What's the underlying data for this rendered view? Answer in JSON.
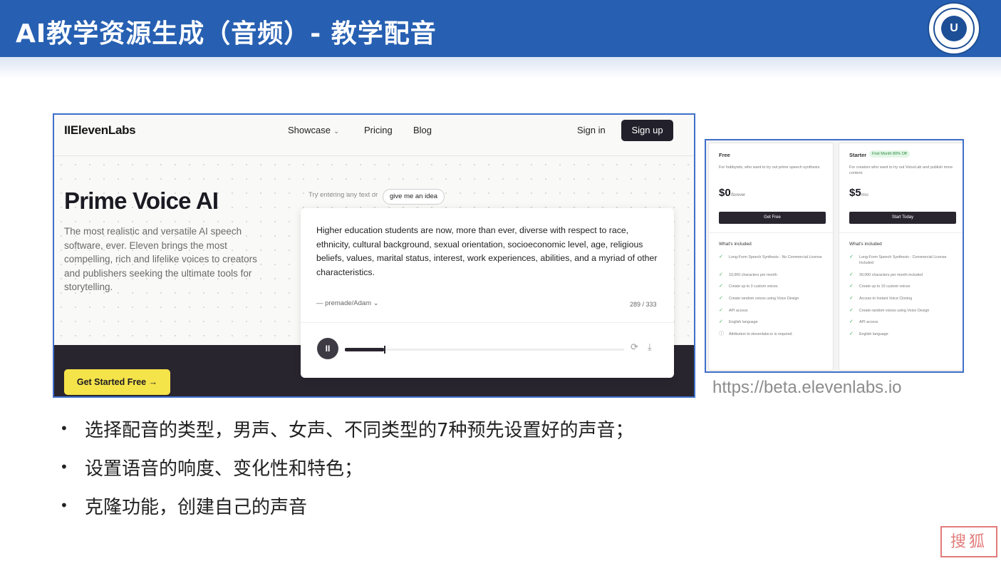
{
  "slide": {
    "title": "AI教学资源生成（音频）- 教学配音",
    "logo_text": "U",
    "url": "https://beta.elevenlabs.io",
    "bullets": [
      "选择配音的类型，男声、女声、不同类型的7种预先设置好的声音；",
      "设置语音的响度、变化性和特色；",
      "克隆功能，创建自己的声音"
    ],
    "bullet_symbol": "•",
    "stamp_text": "搜狐",
    "colors": {
      "title_bar": "#2760b2",
      "frame_border": "#3f6fc9",
      "accent_yellow": "#f5e34a",
      "dark": "#29252f"
    }
  },
  "site": {
    "brand": "IIElevenLabs",
    "nav": {
      "showcase": "Showcase",
      "showcase_chevron": "⌄",
      "pricing": "Pricing",
      "blog": "Blog",
      "sign_in": "Sign in",
      "sign_up": "Sign up"
    },
    "hero": {
      "title": "Prime Voice AI",
      "description": "The most realistic and versatile AI speech software, ever. Eleven brings the most compelling, rich and lifelike voices to creators and publishers seeking the ultimate tools for storytelling.",
      "cta": "Get Started Free →"
    },
    "try": {
      "prompt": "Try entering any text or",
      "idea_button": "give me an idea"
    },
    "editor": {
      "text": "Higher education students are now, more than ever, diverse with respect to race, ethnicity, cultural background, sexual orientation, socioeconomic level, age, religious beliefs, values, marital status, interest, work experiences, abilities, and a myriad of other characteristics.",
      "voice": "— premade/Adam ⌄",
      "char_count": "289 / 333",
      "play_icon": "II",
      "refresh_icon": "⟳",
      "download_icon": "⤓",
      "progress": 0.14
    }
  },
  "pricing": {
    "included_label": "What's included",
    "plans": [
      {
        "name": "Free",
        "badge": "",
        "desc": "For hobbyists, who want to try out prime speech synthesis.",
        "price": "$0",
        "period": "/forever",
        "button": "Get Free",
        "features": [
          "Long-Form Speech Synthesis - No Commercial License",
          "10,000 characters per month",
          "Create up to 3 custom voices",
          "Create random voices using Voice Design",
          "API access",
          "English language",
          "Attribution to elevenlabs.io is required."
        ]
      },
      {
        "name": "Starter",
        "badge": "First Month 80% Off",
        "desc": "For creators who want to try out VoiceLab and publish more content.",
        "price": "$5",
        "period": "/mo",
        "button": "Start Today",
        "features": [
          "Long-Form Speech Synthesis - Commercial License Included",
          "30,000 characters per month included",
          "Create up to 10 custom voices",
          "Access to Instant Voice Cloning",
          "Create random voices using Voice Design",
          "API access",
          "English language"
        ]
      }
    ],
    "check_icon": "✓",
    "info_icon": "ⓘ"
  }
}
